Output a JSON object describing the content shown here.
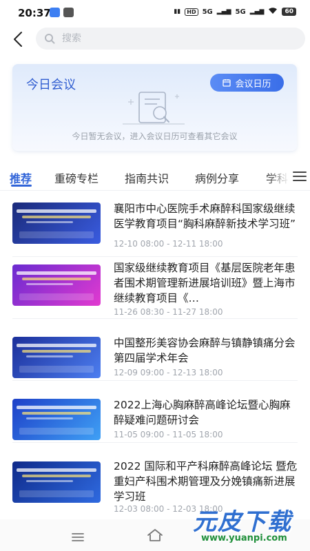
{
  "status_bar": {
    "time": "20:37",
    "hd": "HD",
    "signal_1": "5G",
    "signal_2": "5G",
    "battery": "60"
  },
  "search": {
    "placeholder": "搜索"
  },
  "today_card": {
    "title": "今日会议",
    "calendar_button": "会议日历",
    "empty_text": "今日暂无会议，进入会议日历可查看其它会议"
  },
  "tabs": [
    "推荐",
    "重磅专栏",
    "指南共识",
    "病例分享",
    "学科"
  ],
  "articles": [
    {
      "title": "襄阳市中心医院手术麻醉科国家级继续医学教育项目“胸科麻醉新技术学习班”",
      "date": "12-10 08:00 - 12-11 18:00",
      "thumb_colors": [
        "#1a2a7a",
        "#3a5ce0"
      ]
    },
    {
      "title": "国家级继续教育项目《基层医院老年患者围术期管理新进展培训班》暨上海市继续教育项目《…",
      "date": "11-26 08:30 - 11-27 18:00",
      "thumb_colors": [
        "#6a2bd0",
        "#e23ad0"
      ]
    },
    {
      "title": "中国整形美容协会麻醉与镇静镇痛分会第四届学术年会",
      "date": "12-09 09:00 - 12-13 18:00",
      "thumb_colors": [
        "#1b2f9a",
        "#4d7ef0"
      ]
    },
    {
      "title": "2022上海心胸麻醉高峰论坛暨心胸麻醉疑难问题研讨会",
      "date": "11-05 09:00 - 11-05 18:00",
      "thumb_colors": [
        "#1e40c8",
        "#3fa0f5"
      ]
    },
    {
      "title": "2022 国际和平产科麻醉高峰论坛 暨危重妇产科围术期管理及分娩镇痛新进展学习班",
      "date": "12-03 08:00 - 12-03 18:00",
      "thumb_colors": [
        "#0f2a8a",
        "#2f6ae0"
      ]
    }
  ],
  "watermark": {
    "text": "元皮下载",
    "url": "www.yuanpi.com"
  },
  "colors": {
    "accent": "#2f63d8",
    "card_title": "#2f5cd0"
  }
}
